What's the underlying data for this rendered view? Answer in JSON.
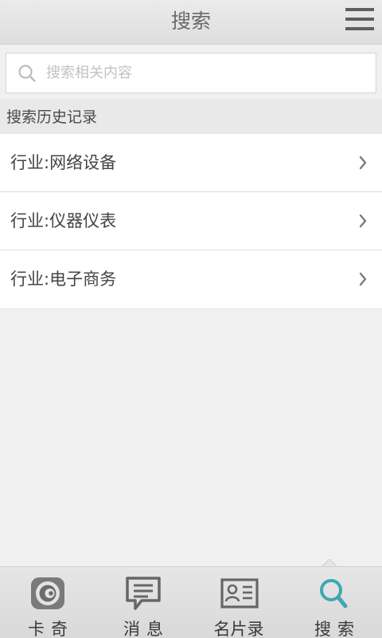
{
  "header": {
    "title": "搜索",
    "menu_icon": "hamburger-menu-icon"
  },
  "search": {
    "placeholder": "搜索相关内容",
    "value": "",
    "icon": "search-icon"
  },
  "history": {
    "title": "搜索历史记录",
    "items": [
      {
        "label": "行业:网络设备"
      },
      {
        "label": "行业:仪器仪表"
      },
      {
        "label": "行业:电子商务"
      }
    ]
  },
  "bottom_nav": {
    "active_color": "#3fa7b5",
    "items": [
      {
        "label": "卡奇",
        "icon": "kaqi-logo-icon",
        "active": false
      },
      {
        "label": "消息",
        "icon": "message-icon",
        "active": false
      },
      {
        "label": "名片录",
        "icon": "business-card-icon",
        "active": false
      },
      {
        "label": "搜索",
        "icon": "search-icon",
        "active": true
      }
    ]
  }
}
